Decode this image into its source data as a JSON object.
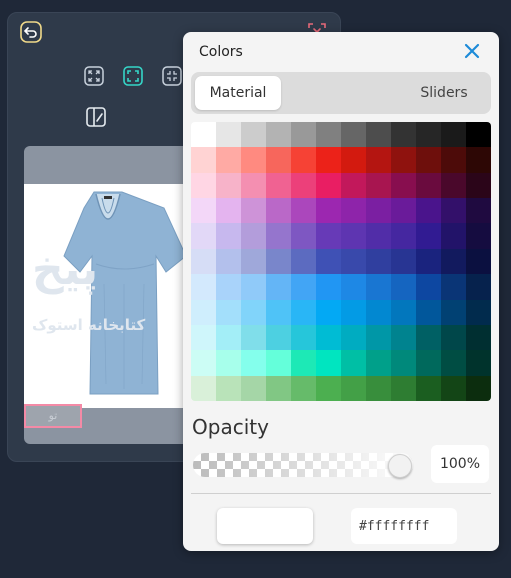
{
  "colors": {
    "title": "Colors",
    "tabs": [
      {
        "label": "Material"
      },
      {
        "label": "Sliders"
      }
    ],
    "opacity_label": "Opacity",
    "opacity_value": "100%",
    "opacity_level": 1.0,
    "hex_value": "#ffffffff",
    "selected_color": "#ffffff",
    "accent": "#1d8bd8"
  },
  "preview": {
    "watermark_primary": "پیخ",
    "watermark_secondary": "کتابخانه استوک",
    "selection_label": "ﺗﻮ"
  },
  "palette_rows": [
    [
      "#ffffff",
      "#e6e6e6",
      "#cccccc",
      "#b3b3b3",
      "#999999",
      "#808080",
      "#666666",
      "#4d4d4d",
      "#333333",
      "#262626",
      "#1a1a1a",
      "#000000"
    ],
    [
      "#ffd3d3",
      "#ffaaa4",
      "#ff8a80",
      "#f7665c",
      "#f64235",
      "#ec2219",
      "#d31a0f",
      "#b41511",
      "#8f120e",
      "#6e0f0c",
      "#4d0b09",
      "#2d0705"
    ],
    [
      "#ffd6e4",
      "#f7b3c9",
      "#f48fb1",
      "#f06292",
      "#ec407a",
      "#e91e63",
      "#c2185b",
      "#a81550",
      "#880e4f",
      "#6a0b3e",
      "#4a082b",
      "#2b0519"
    ],
    [
      "#f3d7f8",
      "#e4b4ef",
      "#ce93d8",
      "#ba68c8",
      "#ab47bc",
      "#9c27b0",
      "#8e24aa",
      "#7b1fa2",
      "#6a1b9a",
      "#4a148c",
      "#33106a",
      "#1f0a40"
    ],
    [
      "#e2d8f7",
      "#c7b8ee",
      "#b39ddb",
      "#9575cd",
      "#7e57c2",
      "#673ab7",
      "#5e35b1",
      "#512da8",
      "#4527a0",
      "#311b92",
      "#221369",
      "#150c40"
    ],
    [
      "#d6ddf6",
      "#b3c0ec",
      "#9fa8da",
      "#7986cb",
      "#5c6bc0",
      "#3f51b5",
      "#3949ab",
      "#303f9f",
      "#283593",
      "#1a237e",
      "#121a5e",
      "#0b1040"
    ],
    [
      "#d3e9fd",
      "#a9d3fa",
      "#90caf9",
      "#64b5f6",
      "#42a5f5",
      "#2196f3",
      "#1e88e5",
      "#1976d2",
      "#1565c0",
      "#0d47a1",
      "#0a3576",
      "#06224d"
    ],
    [
      "#cfeefd",
      "#a3dffb",
      "#81d4fa",
      "#4fc3f7",
      "#29b6f6",
      "#03a9f4",
      "#039be5",
      "#0288d1",
      "#0277bd",
      "#01579b",
      "#014173",
      "#012b4d"
    ],
    [
      "#cff6fb",
      "#a3eef7",
      "#80deea",
      "#4dd0e1",
      "#26c6da",
      "#00bcd4",
      "#00acc1",
      "#0097a7",
      "#00838f",
      "#006064",
      "#00474a",
      "#002f31"
    ],
    [
      "#ccfdf5",
      "#a7ffeb",
      "#84ffec",
      "#64ffda",
      "#1de9b6",
      "#00e5c0",
      "#00bfa5",
      "#00a08a",
      "#00897b",
      "#00695c",
      "#004d43",
      "#00332c"
    ],
    [
      "#d9f0d9",
      "#b9e3b9",
      "#a5d6a7",
      "#81c784",
      "#66bb6a",
      "#4caf50",
      "#43a047",
      "#388e3c",
      "#2e7d32",
      "#1b5e20",
      "#134516",
      "#0c2d0e"
    ]
  ]
}
